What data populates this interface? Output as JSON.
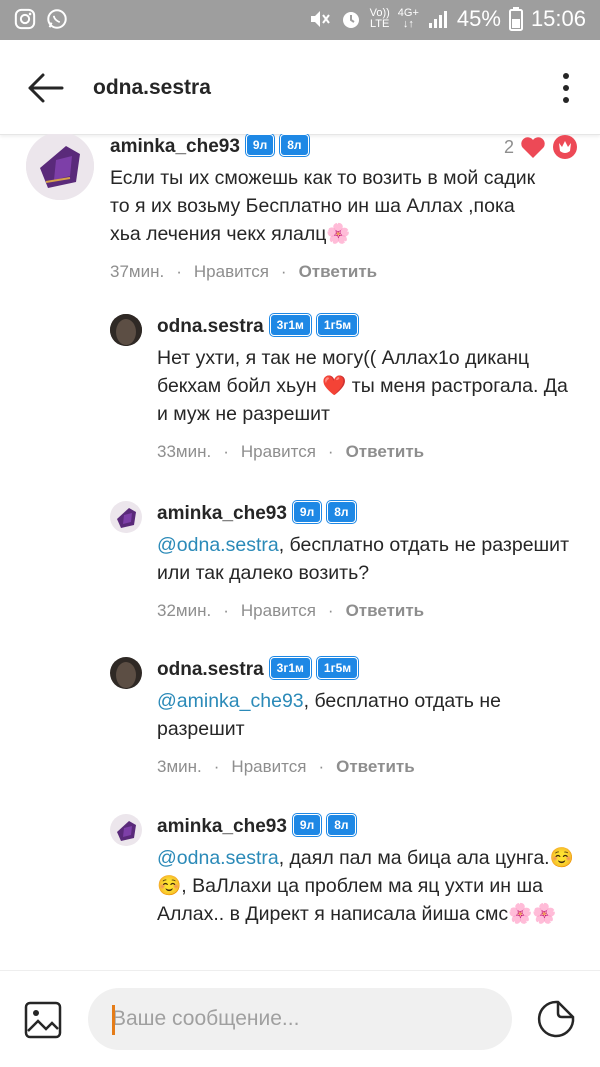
{
  "status_bar": {
    "battery": "45%",
    "time": "15:06",
    "network_vo": "Vo))",
    "network_lte": "LTE",
    "network_4g": "4G+"
  },
  "header": {
    "title": "odna.sestra"
  },
  "comments": [
    {
      "username": "aminka_che93",
      "badges": [
        "9л",
        "8л"
      ],
      "mention": "",
      "text": "Если ты их сможешь как то возить в мой садик то я их возьму Бесплатно ин ша Аллах ,пока хьа лечения чекх ялалц🌸",
      "time": "37мин.",
      "like_label": "Нравится",
      "reply_label": "Ответить",
      "like_count": "2"
    },
    {
      "username": "odna.sestra",
      "badges": [
        "3г1м",
        "1г5м"
      ],
      "mention": "",
      "text": "Нет ухти, я так не могу(( Аллах1о диканц бекхам бойл хьун ❤️ ты меня растрогала. Да и муж не разрешит",
      "time": "33мин.",
      "like_label": "Нравится",
      "reply_label": "Ответить"
    },
    {
      "username": "aminka_che93",
      "badges": [
        "9л",
        "8л"
      ],
      "mention": "@odna.sestra",
      "text": ", бесплатно отдать не разрешит или так далеко возить?",
      "time": "32мин.",
      "like_label": "Нравится",
      "reply_label": "Ответить"
    },
    {
      "username": "odna.sestra",
      "badges": [
        "3г1м",
        "1г5м"
      ],
      "mention": "@aminka_che93",
      "text": ", бесплатно отдать не разрешит",
      "time": "3мин.",
      "like_label": "Нравится",
      "reply_label": "Ответить"
    },
    {
      "username": "aminka_che93",
      "badges": [
        "9л",
        "8л"
      ],
      "mention": "@odna.sestra",
      "text": ", даял пал ма бица ала цунга.☺️☺️, ВаЛлахи ца проблем ма яц ухти ин ша Аллах.. в Директ я написала йиша смс🌸🌸"
    }
  ],
  "composer": {
    "placeholder": "Ваше сообщение..."
  },
  "colors": {
    "badge": "#1e88e5",
    "mention": "#2b8ab8",
    "heart": "#ed4956",
    "cursor": "#e57c18",
    "status_bar": "#9e9e9e"
  }
}
